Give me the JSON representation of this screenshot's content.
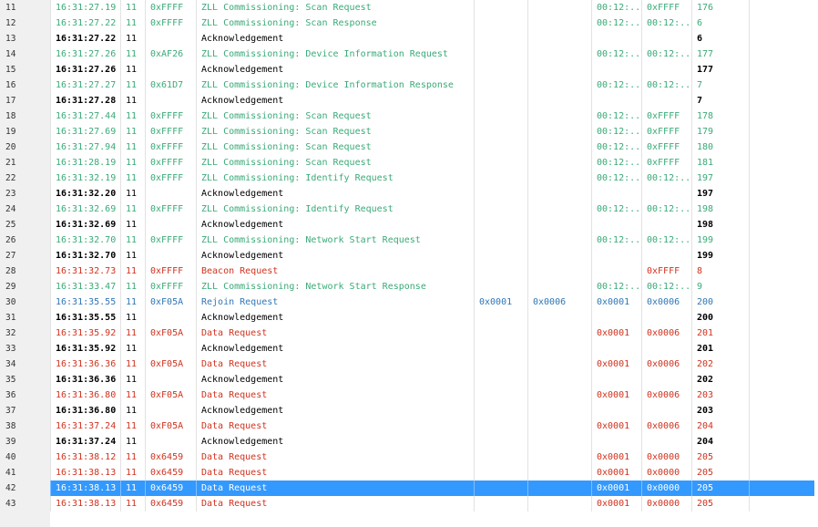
{
  "colors": {
    "ack": "#000000",
    "zll": "#3aaa78",
    "red": "#d1321e",
    "blue": "#2f76b8",
    "selected_text": "#ffffff",
    "selected_bg": "#3399ff"
  },
  "rows": [
    {
      "num": "11",
      "time": "16:31:27.19",
      "ch": "11",
      "src": "0xFFFF",
      "desc": "ZLL Commissioning: Scan Request",
      "a": "",
      "b": "",
      "c": "00:12:...",
      "d": "0xFFFF",
      "seq": "176",
      "kind": "zll"
    },
    {
      "num": "12",
      "time": "16:31:27.22",
      "ch": "11",
      "src": "0xFFFF",
      "desc": "ZLL Commissioning: Scan Response",
      "a": "",
      "b": "",
      "c": "00:12:...",
      "d": "00:12:...",
      "seq": "6",
      "kind": "zll"
    },
    {
      "num": "13",
      "time": "16:31:27.22",
      "ch": "11",
      "src": "",
      "desc": "Acknowledgement",
      "a": "",
      "b": "",
      "c": "",
      "d": "",
      "seq": "6",
      "kind": "ack"
    },
    {
      "num": "14",
      "time": "16:31:27.26",
      "ch": "11",
      "src": "0xAF26",
      "desc": "ZLL Commissioning: Device Information Request",
      "a": "",
      "b": "",
      "c": "00:12:...",
      "d": "00:12:...",
      "seq": "177",
      "kind": "zll"
    },
    {
      "num": "15",
      "time": "16:31:27.26",
      "ch": "11",
      "src": "",
      "desc": "Acknowledgement",
      "a": "",
      "b": "",
      "c": "",
      "d": "",
      "seq": "177",
      "kind": "ack"
    },
    {
      "num": "16",
      "time": "16:31:27.27",
      "ch": "11",
      "src": "0x61D7",
      "desc": "ZLL Commissioning: Device Information Response",
      "a": "",
      "b": "",
      "c": "00:12:...",
      "d": "00:12:...",
      "seq": "7",
      "kind": "zll"
    },
    {
      "num": "17",
      "time": "16:31:27.28",
      "ch": "11",
      "src": "",
      "desc": "Acknowledgement",
      "a": "",
      "b": "",
      "c": "",
      "d": "",
      "seq": "7",
      "kind": "ack"
    },
    {
      "num": "18",
      "time": "16:31:27.44",
      "ch": "11",
      "src": "0xFFFF",
      "desc": "ZLL Commissioning: Scan Request",
      "a": "",
      "b": "",
      "c": "00:12:...",
      "d": "0xFFFF",
      "seq": "178",
      "kind": "zll"
    },
    {
      "num": "19",
      "time": "16:31:27.69",
      "ch": "11",
      "src": "0xFFFF",
      "desc": "ZLL Commissioning: Scan Request",
      "a": "",
      "b": "",
      "c": "00:12:...",
      "d": "0xFFFF",
      "seq": "179",
      "kind": "zll"
    },
    {
      "num": "20",
      "time": "16:31:27.94",
      "ch": "11",
      "src": "0xFFFF",
      "desc": "ZLL Commissioning: Scan Request",
      "a": "",
      "b": "",
      "c": "00:12:...",
      "d": "0xFFFF",
      "seq": "180",
      "kind": "zll"
    },
    {
      "num": "21",
      "time": "16:31:28.19",
      "ch": "11",
      "src": "0xFFFF",
      "desc": "ZLL Commissioning: Scan Request",
      "a": "",
      "b": "",
      "c": "00:12:...",
      "d": "0xFFFF",
      "seq": "181",
      "kind": "zll"
    },
    {
      "num": "22",
      "time": "16:31:32.19",
      "ch": "11",
      "src": "0xFFFF",
      "desc": "ZLL Commissioning: Identify Request",
      "a": "",
      "b": "",
      "c": "00:12:...",
      "d": "00:12:...",
      "seq": "197",
      "kind": "zll"
    },
    {
      "num": "23",
      "time": "16:31:32.20",
      "ch": "11",
      "src": "",
      "desc": "Acknowledgement",
      "a": "",
      "b": "",
      "c": "",
      "d": "",
      "seq": "197",
      "kind": "ack"
    },
    {
      "num": "24",
      "time": "16:31:32.69",
      "ch": "11",
      "src": "0xFFFF",
      "desc": "ZLL Commissioning: Identify Request",
      "a": "",
      "b": "",
      "c": "00:12:...",
      "d": "00:12:...",
      "seq": "198",
      "kind": "zll"
    },
    {
      "num": "25",
      "time": "16:31:32.69",
      "ch": "11",
      "src": "",
      "desc": "Acknowledgement",
      "a": "",
      "b": "",
      "c": "",
      "d": "",
      "seq": "198",
      "kind": "ack"
    },
    {
      "num": "26",
      "time": "16:31:32.70",
      "ch": "11",
      "src": "0xFFFF",
      "desc": "ZLL Commissioning: Network Start Request",
      "a": "",
      "b": "",
      "c": "00:12:...",
      "d": "00:12:...",
      "seq": "199",
      "kind": "zll"
    },
    {
      "num": "27",
      "time": "16:31:32.70",
      "ch": "11",
      "src": "",
      "desc": "Acknowledgement",
      "a": "",
      "b": "",
      "c": "",
      "d": "",
      "seq": "199",
      "kind": "ack"
    },
    {
      "num": "28",
      "time": "16:31:32.73",
      "ch": "11",
      "src": "0xFFFF",
      "desc": "Beacon Request",
      "a": "",
      "b": "",
      "c": "",
      "d": "0xFFFF",
      "seq": "8",
      "kind": "red"
    },
    {
      "num": "29",
      "time": "16:31:33.47",
      "ch": "11",
      "src": "0xFFFF",
      "desc": "ZLL Commissioning: Network Start Response",
      "a": "",
      "b": "",
      "c": "00:12:...",
      "d": "00:12:...",
      "seq": "9",
      "kind": "zll"
    },
    {
      "num": "30",
      "time": "16:31:35.55",
      "ch": "11",
      "src": "0xF05A",
      "desc": "Rejoin Request",
      "a": "0x0001",
      "b": "0x0006",
      "c": "0x0001",
      "d": "0x0006",
      "seq": "200",
      "kind": "blue"
    },
    {
      "num": "31",
      "time": "16:31:35.55",
      "ch": "11",
      "src": "",
      "desc": "Acknowledgement",
      "a": "",
      "b": "",
      "c": "",
      "d": "",
      "seq": "200",
      "kind": "ack"
    },
    {
      "num": "32",
      "time": "16:31:35.92",
      "ch": "11",
      "src": "0xF05A",
      "desc": "Data Request",
      "a": "",
      "b": "",
      "c": "0x0001",
      "d": "0x0006",
      "seq": "201",
      "kind": "red"
    },
    {
      "num": "33",
      "time": "16:31:35.92",
      "ch": "11",
      "src": "",
      "desc": "Acknowledgement",
      "a": "",
      "b": "",
      "c": "",
      "d": "",
      "seq": "201",
      "kind": "ack"
    },
    {
      "num": "34",
      "time": "16:31:36.36",
      "ch": "11",
      "src": "0xF05A",
      "desc": "Data Request",
      "a": "",
      "b": "",
      "c": "0x0001",
      "d": "0x0006",
      "seq": "202",
      "kind": "red"
    },
    {
      "num": "35",
      "time": "16:31:36.36",
      "ch": "11",
      "src": "",
      "desc": "Acknowledgement",
      "a": "",
      "b": "",
      "c": "",
      "d": "",
      "seq": "202",
      "kind": "ack"
    },
    {
      "num": "36",
      "time": "16:31:36.80",
      "ch": "11",
      "src": "0xF05A",
      "desc": "Data Request",
      "a": "",
      "b": "",
      "c": "0x0001",
      "d": "0x0006",
      "seq": "203",
      "kind": "red"
    },
    {
      "num": "37",
      "time": "16:31:36.80",
      "ch": "11",
      "src": "",
      "desc": "Acknowledgement",
      "a": "",
      "b": "",
      "c": "",
      "d": "",
      "seq": "203",
      "kind": "ack"
    },
    {
      "num": "38",
      "time": "16:31:37.24",
      "ch": "11",
      "src": "0xF05A",
      "desc": "Data Request",
      "a": "",
      "b": "",
      "c": "0x0001",
      "d": "0x0006",
      "seq": "204",
      "kind": "red"
    },
    {
      "num": "39",
      "time": "16:31:37.24",
      "ch": "11",
      "src": "",
      "desc": "Acknowledgement",
      "a": "",
      "b": "",
      "c": "",
      "d": "",
      "seq": "204",
      "kind": "ack"
    },
    {
      "num": "40",
      "time": "16:31:38.12",
      "ch": "11",
      "src": "0x6459",
      "desc": "Data Request",
      "a": "",
      "b": "",
      "c": "0x0001",
      "d": "0x0000",
      "seq": "205",
      "kind": "red"
    },
    {
      "num": "41",
      "time": "16:31:38.13",
      "ch": "11",
      "src": "0x6459",
      "desc": "Data Request",
      "a": "",
      "b": "",
      "c": "0x0001",
      "d": "0x0000",
      "seq": "205",
      "kind": "red"
    },
    {
      "num": "42",
      "time": "16:31:38.13",
      "ch": "11",
      "src": "0x6459",
      "desc": "Data Request",
      "a": "",
      "b": "",
      "c": "0x0001",
      "d": "0x0000",
      "seq": "205",
      "kind": "selected"
    },
    {
      "num": "43",
      "time": "16:31:38.13",
      "ch": "11",
      "src": "0x6459",
      "desc": "Data Request",
      "a": "",
      "b": "",
      "c": "0x0001",
      "d": "0x0000",
      "seq": "205",
      "kind": "red"
    }
  ]
}
